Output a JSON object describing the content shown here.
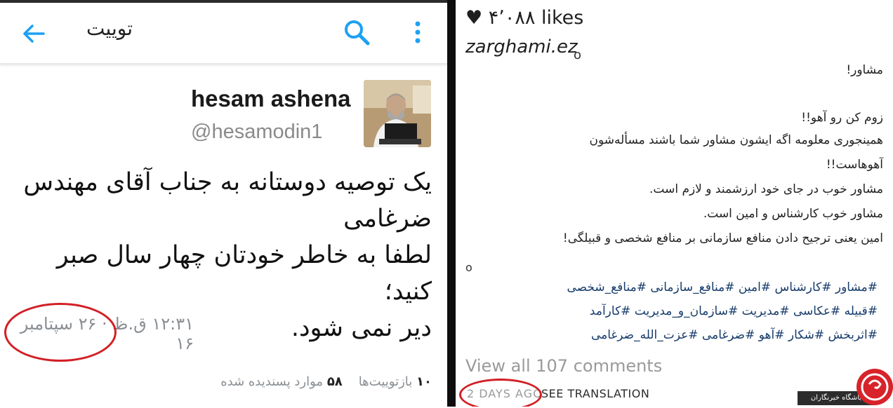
{
  "twitter": {
    "app_title": "توییت",
    "author_name": "hesam ashena",
    "author_handle": "@hesamodin1",
    "tweet_lines": [
      "یک توصیه دوستانه به جناب آقای مهندس",
      "ضرغامی",
      "لطفا به خاطر خودتان چهار سال صبر کنید؛",
      "دیر نمی شود."
    ],
    "time": "۱۲:۳۱ ق.ظ · ۲۶ سپتامبر ۱۶",
    "retweets_count": "۱۰",
    "retweets_label": "بازتوییت‌ها",
    "likes_count": "۵۸",
    "likes_label": "موارد پسندیده شده"
  },
  "instagram": {
    "likes": "♥ ۴٬۰۸۸ likes",
    "username": "zarghami.ez",
    "caption_lines": [
      "مشاور!",
      "زوم کن رو آهو!!",
      "همینجوری معلومه اگه ایشون مشاور شما باشند مسأله‌شون",
      "آهوهاست!!",
      "مشاور خوب در جای خود ارزشمند و لازم است.",
      "مشاور خوب کارشناس و امین است.",
      "امین یعنی ترجیح دادن منافع سازمانی بر منافع شخصی و قبیلگی!"
    ],
    "hashtag_lines": [
      "#مشاور #کارشناس #امین #منافع_سازمانی #منافع_شخصی",
      "#قبیله #عکاسی #مدیریت #سازمان_و_مدیریت #کارآمد",
      "#اثربخش #شکار #آهو #ضرغامی #عزت_الله_ضرغامی"
    ],
    "view_all": "View all 107 comments",
    "time_ago": "2 DAYS AGO",
    "see_translation": "SEE TRANSLATION"
  },
  "watermark": {
    "label": "باشگاه خبرنگاران"
  },
  "colors": {
    "accent_blue": "#1da1f2",
    "highlight_red": "#d21f25",
    "hashtag_blue": "#163b6b"
  }
}
